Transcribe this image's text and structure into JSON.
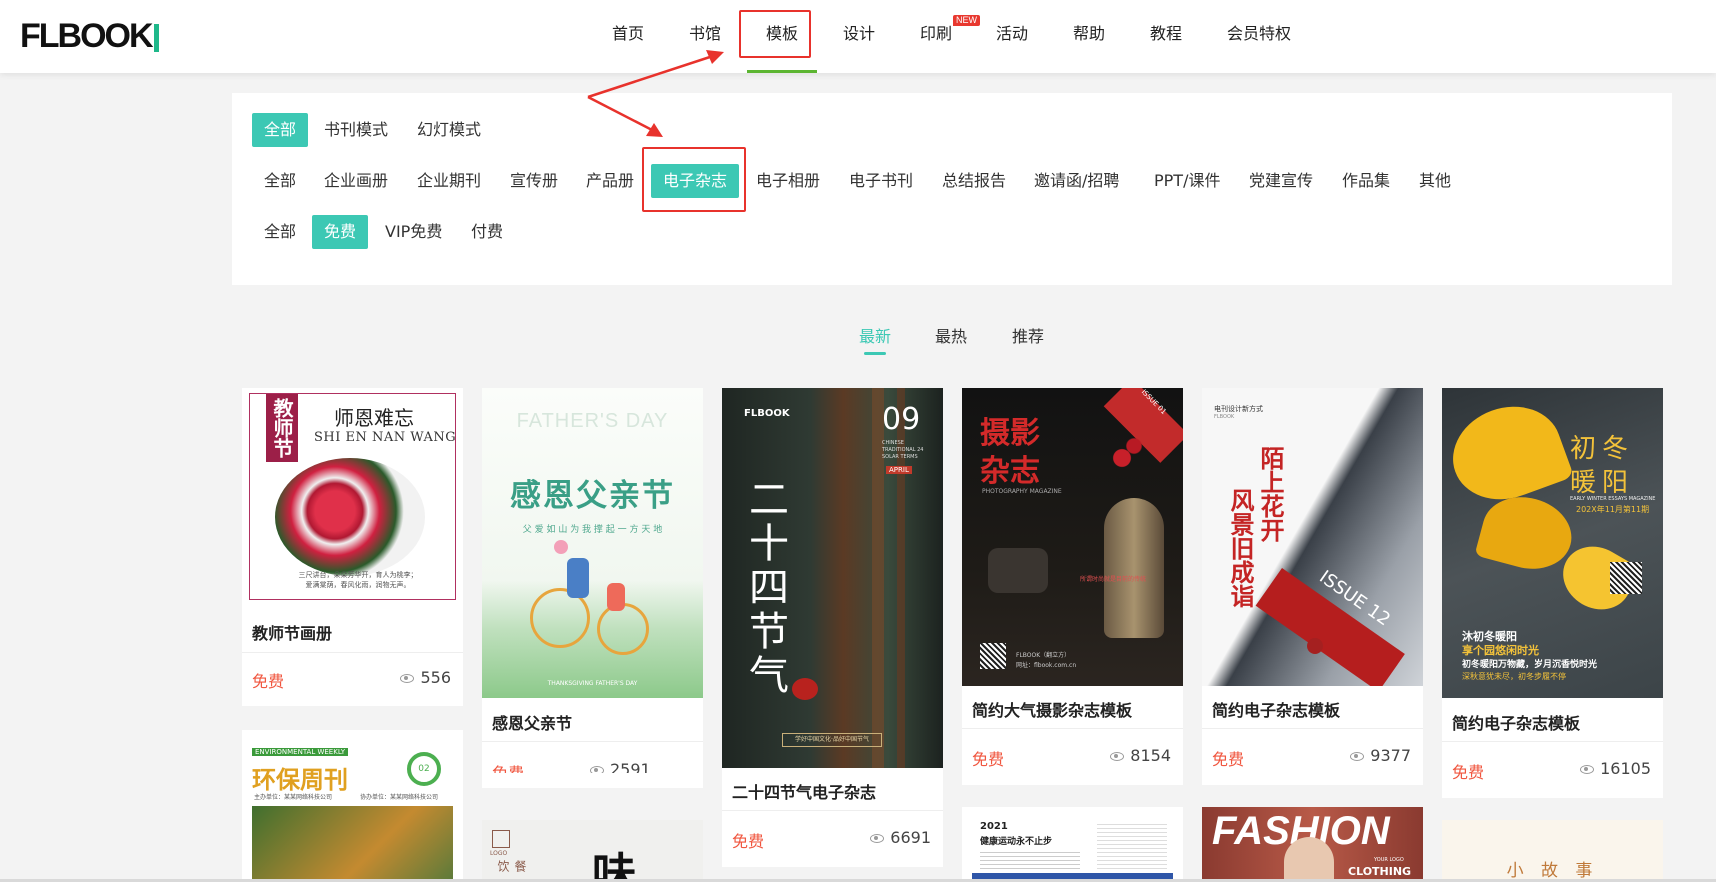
{
  "logo": {
    "text": "FLBOOK"
  },
  "nav": {
    "items": [
      "首页",
      "书馆",
      "模板",
      "设计",
      "印刷",
      "活动",
      "帮助",
      "教程",
      "会员特权"
    ],
    "new_badge": "NEW",
    "active_index": 2
  },
  "filters": {
    "mode": [
      "全部",
      "书刊模式",
      "幻灯模式"
    ],
    "categories": [
      "全部",
      "企业画册",
      "企业期刊",
      "宣传册",
      "产品册",
      "电子杂志",
      "电子相册",
      "电子书刊",
      "总结报告",
      "邀请函/招聘",
      "PPT/课件",
      "党建宣传",
      "作品集",
      "其他"
    ],
    "price": [
      "全部",
      "免费",
      "VIP免费",
      "付费"
    ]
  },
  "sort_tabs": [
    "最新",
    "最热",
    "推荐"
  ],
  "cards": [
    {
      "title": "教师节画册",
      "price": "免费",
      "views": "556",
      "thumb": {
        "vt": "教师节",
        "heading": "师恩难忘",
        "sub": "SHI EN NAN WANG",
        "caption": "三尺讲台，朵朵芳华开，育人为桃李；\n爱满棠荫，春风化雨，润物无声。"
      }
    },
    {
      "title": "感恩父亲节",
      "price": "免费",
      "views": "2591",
      "thumb": {
        "en": "FATHER'S DAY",
        "heading": "感恩父亲节",
        "sub": "父 爱 如 山   为 我 撑 起 一 方 天 地",
        "foot": "THANKSGIVING FATHER'S DAY"
      }
    },
    {
      "title": "二十四节气电子杂志",
      "price": "免费",
      "views": "6691",
      "thumb": {
        "brand": "FLBOOK",
        "num": "09",
        "en": "CHINESE TRADITIONAL 24 SOLAR TERMS",
        "month": "APRIL",
        "heading": "二十四节气",
        "foot": "学好中国文化·品好中国节气"
      }
    },
    {
      "title": "简约大气摄影杂志模板",
      "price": "免费",
      "views": "8154",
      "thumb": {
        "issue": "ISSUE 01",
        "heading1": "摄影",
        "heading2": "杂志",
        "sub": "用摄影记录生活的美好",
        "en": "PHOTOGRAPHY MAGAZINE",
        "tag": "所谓时尚就是目前的传统",
        "foot": "FLBOOK（翻立方）",
        "site": "网址：flbook.com.cn"
      }
    },
    {
      "title": "简约电子杂志模板",
      "price": "免费",
      "views": "9377",
      "thumb": {
        "top": "电刊设计新方式",
        "brand": "FLBOOK",
        "vt1": "陌上花开",
        "vt2": "风景旧成诣",
        "issue": "ISSUE 12"
      }
    },
    {
      "title": "简约电子杂志模板",
      "price": "免费",
      "views": "16105",
      "thumb": {
        "h1": "初冬",
        "h2": "暖阳",
        "en": "EARLY WINTER ESSAYS MAGAZINE",
        "date": "202X年11月第11期",
        "tag1": "沐初冬暖阳",
        "tag2": "享个园悠闲时光",
        "tag3": "初冬暖阳万物藏，岁月沉香悦时光",
        "tag4": "深秋意犹未尽，初冬步履不停"
      }
    }
  ],
  "partial_cards": {
    "eco": {
      "badge": "ENVIRONMENTAL WEEKLY",
      "heading": "环保周刊",
      "num": "02",
      "left": "主办单位：某某网络科技公司",
      "right": "协办单位：某某网络科技公司"
    },
    "taste": {
      "logo": "LOGO",
      "vt": "餐饮",
      "heading": "味"
    },
    "sport": {
      "year": "2021",
      "heading": "健康运动永不止步"
    },
    "fashion": {
      "heading": "FASHION",
      "sub": "CLOTHING",
      "logo": "YOUR LOGO"
    },
    "story": {
      "heading": "小 故 事"
    }
  }
}
